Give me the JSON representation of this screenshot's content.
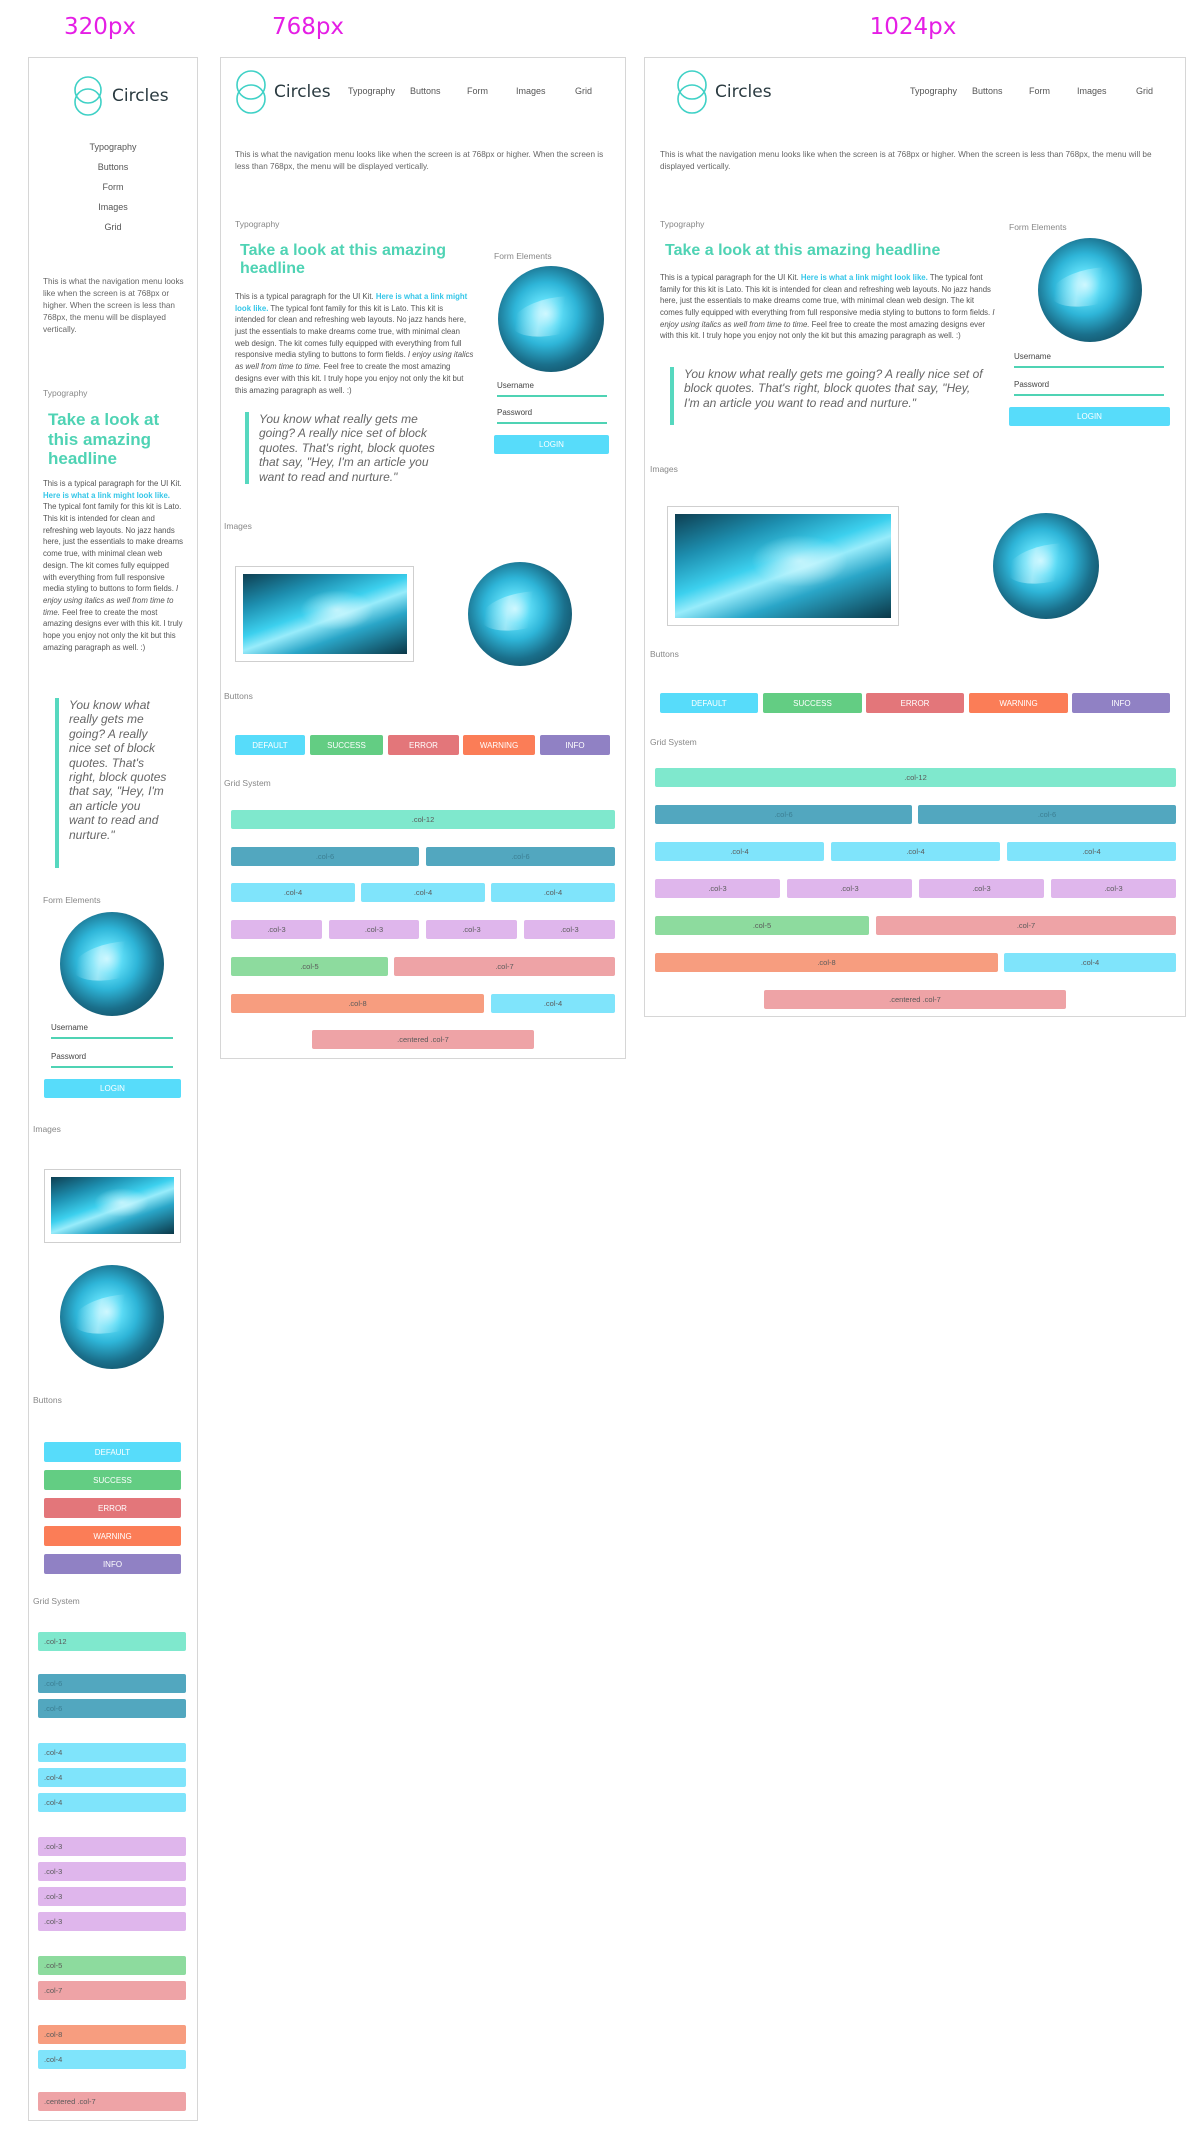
{
  "breakpoints": [
    "320px",
    "768px",
    "1024px"
  ],
  "brand": "Circles",
  "nav_items": [
    "Typography",
    "Buttons",
    "Form",
    "Images",
    "Grid"
  ],
  "intro": "This is what the navigation menu looks like when the screen is at 768px or higher. When the screen is less than 768px, the menu will be displayed vertically.",
  "sections": {
    "typography": "Typography",
    "form": "Form Elements",
    "images": "Images",
    "buttons": "Buttons",
    "grid": "Grid System"
  },
  "headline": "Take a look at this amazing headline",
  "paragraph": {
    "lead": "This is a typical paragraph for the UI Kit. ",
    "link": "Here is what a link might look like.",
    "body": " The typical font family for this kit is Lato. This kit is intended for clean and refreshing web layouts. No jazz hands here, just the essentials to make dreams come true, with minimal clean web design. The kit comes fully equipped with everything from full responsive media styling to buttons to form fields. ",
    "italic": "I enjoy using italics as well from time to time.",
    "tail": " Feel free to create the most amazing designs ever with this kit. I truly hope you enjoy not only the kit but this amazing paragraph as well. :)"
  },
  "blockquote": "You know what really gets me going? A really nice set of block quotes. That's right, block quotes that say, \"Hey, I'm an article you want to read and nurture.\"",
  "form": {
    "username": "Username",
    "password": "Password",
    "login": "LOGIN"
  },
  "buttons": [
    "DEFAULT",
    "SUCCESS",
    "ERROR",
    "WARNING",
    "INFO"
  ],
  "grid": {
    "col12": ".col-12",
    "col6": ".col-6",
    "col4": ".col-4",
    "col3": ".col-3",
    "col5": ".col-5",
    "col7": ".col-7",
    "col8": ".col-8",
    "centered": ".centered .col-7"
  },
  "colors": {
    "accent": "#4fd3b4",
    "link": "#34c6e8",
    "label": "#e51ee5",
    "default": "#57dcfa",
    "success": "#63cd83",
    "error": "#e3767a",
    "warning": "#fb7d57",
    "info": "#9081c4"
  }
}
